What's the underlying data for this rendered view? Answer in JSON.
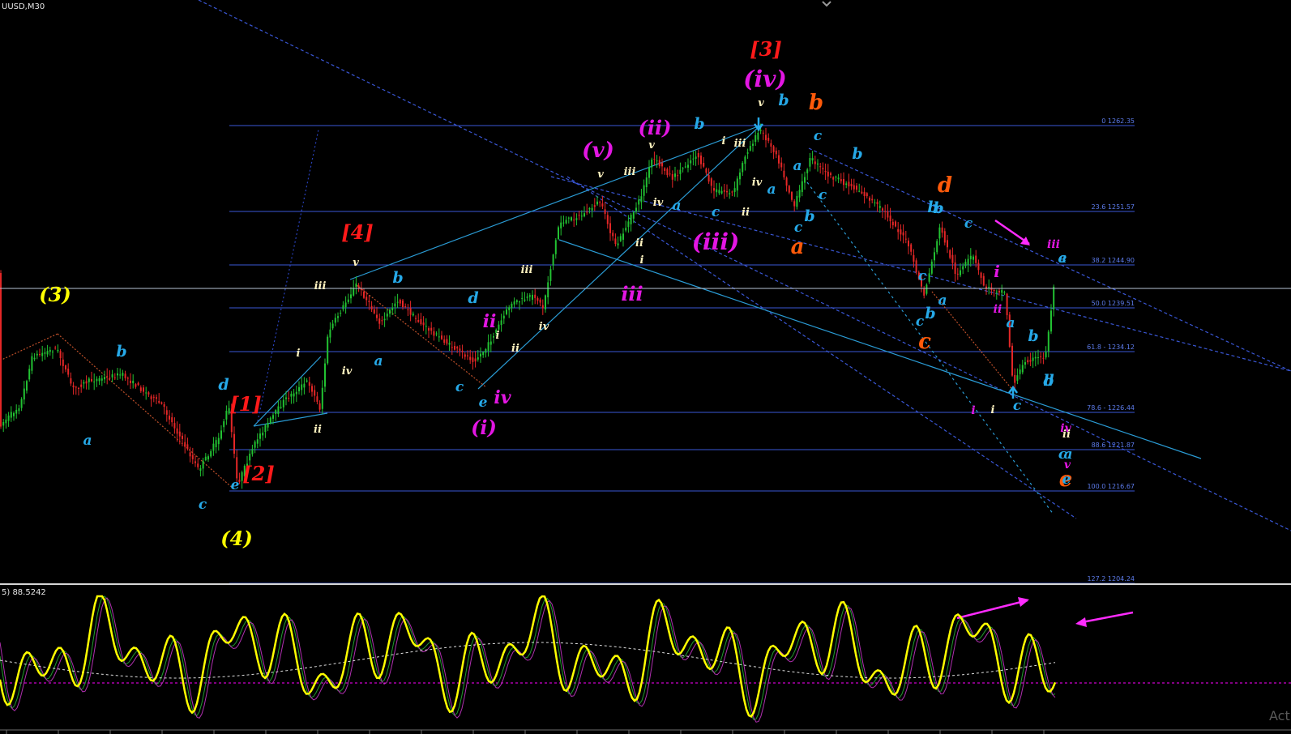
{
  "header": {
    "symbol_label": "UUSD,M30"
  },
  "indicator": {
    "label": "5) 88.5242"
  },
  "watermark": {
    "text": "Act"
  },
  "colors": {
    "background": "#000000",
    "fib_line": "#3a57d6",
    "channel": "#2a9bd4",
    "price_line": "#b7c5d6",
    "bull_candle": "#22c232",
    "bear_candle": "#e52727",
    "osc_main": "#ffff00",
    "osc_level": "#ff00ff"
  },
  "fib_levels": [
    {
      "text": "0 1262.35"
    },
    {
      "text": "23.6 1251.57"
    },
    {
      "text": "38.2 1244.90"
    },
    {
      "text": "50.0 1239.51"
    },
    {
      "text": "61.8 - 1234.12"
    },
    {
      "text": "78.6 - 1226.44"
    },
    {
      "text": "88.6 1221.87"
    },
    {
      "text": "100.0 1216.67"
    },
    {
      "text": "127.2 1204.24"
    }
  ],
  "wave_labels": [
    {
      "text": "(3)",
      "color": "#ffff00",
      "size": 24
    },
    {
      "text": "(4)",
      "color": "#ffff00",
      "size": 24
    },
    {
      "text": "[1]",
      "color": "#ff1a1a",
      "size": 24
    },
    {
      "text": "[2]",
      "color": "#ff1a1a",
      "size": 24
    },
    {
      "text": "[3]",
      "color": "#ff1a1a",
      "size": 24
    },
    {
      "text": "[4]",
      "color": "#ff1a1a",
      "size": 24
    },
    {
      "text": "(i)",
      "color": "#e316e3",
      "size": 24
    },
    {
      "text": "(ii)",
      "color": "#e316e3",
      "size": 24
    },
    {
      "text": "(iii)",
      "color": "#e316e3",
      "size": 28
    },
    {
      "text": "(iv)",
      "color": "#e316e3",
      "size": 28
    },
    {
      "text": "(v)",
      "color": "#e316e3",
      "size": 26
    },
    {
      "text": "iii",
      "color": "#e316e3",
      "size": 24
    },
    {
      "text": "iv",
      "color": "#e316e3",
      "size": 22
    },
    {
      "text": "ii",
      "color": "#e316e3",
      "size": 22
    },
    {
      "text": "i",
      "color": "#e316e3",
      "size": 20
    },
    {
      "text": "ii",
      "color": "#e316e3",
      "size": 14
    },
    {
      "text": "i",
      "color": "#e316e3",
      "size": 14
    },
    {
      "text": "iii",
      "color": "#e316e3",
      "size": 14
    },
    {
      "text": "iv",
      "color": "#e316e3",
      "size": 14
    },
    {
      "text": "v",
      "color": "#e316e3",
      "size": 14
    },
    {
      "text": "a",
      "color": "#ff5a0a",
      "size": 26
    },
    {
      "text": "b",
      "color": "#ff5a0a",
      "size": 26
    },
    {
      "text": "c",
      "color": "#ff5a0a",
      "size": 26
    },
    {
      "text": "d",
      "color": "#ff5a0a",
      "size": 26
    },
    {
      "text": "e",
      "color": "#ff5a0a",
      "size": 26
    },
    {
      "text": "a",
      "color": "#26a9e8",
      "size": 17
    },
    {
      "text": "b",
      "color": "#26a9e8",
      "size": 19
    },
    {
      "text": "c",
      "color": "#26a9e8",
      "size": 17
    },
    {
      "text": "d",
      "color": "#26a9e8",
      "size": 19
    },
    {
      "text": "e",
      "color": "#26a9e8",
      "size": 17
    },
    {
      "text": "c",
      "color": "#26a9e8",
      "size": 17
    },
    {
      "text": "e",
      "color": "#26a9e8",
      "size": 17
    },
    {
      "text": "a",
      "color": "#26a9e8",
      "size": 17
    },
    {
      "text": "b",
      "color": "#26a9e8",
      "size": 19
    },
    {
      "text": "d",
      "color": "#26a9e8",
      "size": 19
    },
    {
      "text": "c",
      "color": "#26a9e8",
      "size": 17
    },
    {
      "text": "e",
      "color": "#26a9e8",
      "size": 17
    },
    {
      "text": "b",
      "color": "#26a9e8",
      "size": 19
    },
    {
      "text": "a",
      "color": "#26a9e8",
      "size": 17
    },
    {
      "text": "c",
      "color": "#26a9e8",
      "size": 17
    },
    {
      "text": "b",
      "color": "#26a9e8",
      "size": 19
    },
    {
      "text": "a",
      "color": "#26a9e8",
      "size": 17
    },
    {
      "text": "c",
      "color": "#26a9e8",
      "size": 17
    },
    {
      "text": "b",
      "color": "#26a9e8",
      "size": 19
    },
    {
      "text": "a",
      "color": "#26a9e8",
      "size": 17
    },
    {
      "text": "c",
      "color": "#26a9e8",
      "size": 17
    },
    {
      "text": "b",
      "color": "#26a9e8",
      "size": 19
    },
    {
      "text": "a",
      "color": "#26a9e8",
      "size": 17
    },
    {
      "text": "b",
      "color": "#26a9e8",
      "size": 19
    },
    {
      "text": "c",
      "color": "#26a9e8",
      "size": 17
    },
    {
      "text": "c",
      "color": "#26a9e8",
      "size": 17
    },
    {
      "text": "b",
      "color": "#26a9e8",
      "size": 19
    },
    {
      "text": "c",
      "color": "#26a9e8",
      "size": 17
    },
    {
      "text": "b",
      "color": "#26a9e8",
      "size": 19
    },
    {
      "text": "a",
      "color": "#26a9e8",
      "size": 17
    },
    {
      "text": "a",
      "color": "#26a9e8",
      "size": 17
    },
    {
      "text": "b",
      "color": "#26a9e8",
      "size": 19
    },
    {
      "text": "c",
      "color": "#26a9e8",
      "size": 17
    },
    {
      "text": "a",
      "color": "#26a9e8",
      "size": 17
    },
    {
      "text": "c",
      "color": "#26a9e8",
      "size": 17
    },
    {
      "text": "d",
      "color": "#26a9e8",
      "size": 19
    },
    {
      "text": "b",
      "color": "#26a9e8",
      "size": 19
    },
    {
      "text": "e",
      "color": "#26a9e8",
      "size": 17
    },
    {
      "text": "c",
      "color": "#26a9e8",
      "size": 17
    },
    {
      "text": "i",
      "color": "#fff3c0",
      "size": 13
    },
    {
      "text": "ii",
      "color": "#fff3c0",
      "size": 13
    },
    {
      "text": "iii",
      "color": "#fff3c0",
      "size": 13
    },
    {
      "text": "iv",
      "color": "#fff3c0",
      "size": 13
    },
    {
      "text": "v",
      "color": "#fff3c0",
      "size": 13
    },
    {
      "text": "i",
      "color": "#fff3c0",
      "size": 13
    },
    {
      "text": "ii",
      "color": "#fff3c0",
      "size": 13
    },
    {
      "text": "iii",
      "color": "#fff3c0",
      "size": 13
    },
    {
      "text": "iv",
      "color": "#fff3c0",
      "size": 13
    },
    {
      "text": "v",
      "color": "#fff3c0",
      "size": 13
    },
    {
      "text": "i",
      "color": "#fff3c0",
      "size": 13
    },
    {
      "text": "ii",
      "color": "#fff3c0",
      "size": 13
    },
    {
      "text": "iii",
      "color": "#fff3c0",
      "size": 13
    },
    {
      "text": "iv",
      "color": "#fff3c0",
      "size": 13
    },
    {
      "text": "v",
      "color": "#fff3c0",
      "size": 13
    },
    {
      "text": "i",
      "color": "#fff3c0",
      "size": 13
    },
    {
      "text": "ii",
      "color": "#fff3c0",
      "size": 13
    },
    {
      "text": "iii",
      "color": "#fff3c0",
      "size": 13
    },
    {
      "text": "iv",
      "color": "#fff3c0",
      "size": 13
    },
    {
      "text": "v",
      "color": "#fff3c0",
      "size": 13
    },
    {
      "text": "i",
      "color": "#fff3c0",
      "size": 13
    },
    {
      "text": "ii",
      "color": "#fff3c0",
      "size": 13
    }
  ]
}
